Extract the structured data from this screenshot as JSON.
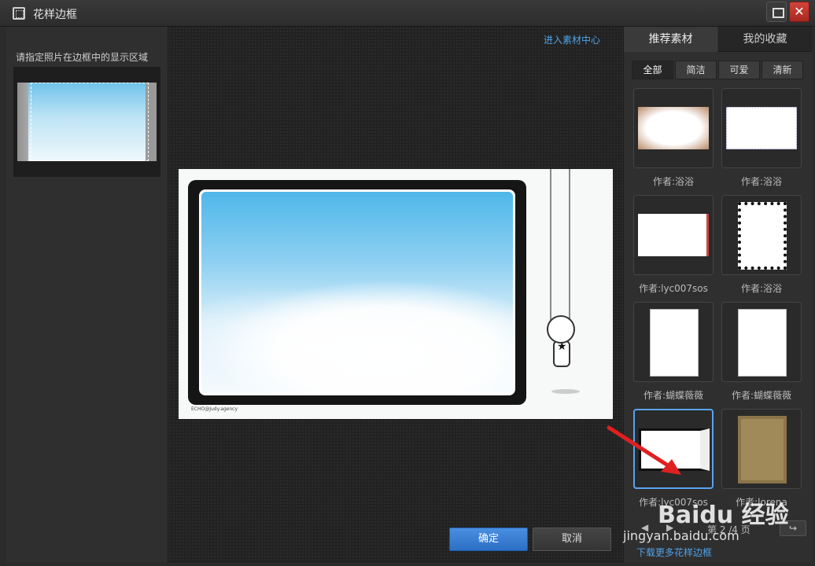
{
  "window": {
    "title": "花样边框",
    "close_glyph": "✕"
  },
  "left_panel": {
    "label": "请指定照片在边框中的显示区域"
  },
  "center": {
    "enter_link": "进入素材中心",
    "preview_credit": "ECHO@Judy.agency",
    "ok_label": "确定",
    "cancel_label": "取消"
  },
  "right_panel": {
    "tabs": [
      {
        "label": "推荐素材"
      },
      {
        "label": "我的收藏"
      }
    ],
    "filters": [
      {
        "label": "全部"
      },
      {
        "label": "简洁"
      },
      {
        "label": "可爱"
      },
      {
        "label": "清新"
      }
    ],
    "items": [
      {
        "caption": "作者:浴浴"
      },
      {
        "caption": "作者:浴浴"
      },
      {
        "caption": "作者:lyc007sos"
      },
      {
        "caption": "作者:浴浴"
      },
      {
        "caption": "作者:蝴蝶薇薇"
      },
      {
        "caption": "作者:蝴蝶薇薇"
      },
      {
        "caption": "作者:lyc007sos"
      },
      {
        "caption": "作者:lorena"
      }
    ],
    "pager": {
      "prev_glyph": "◀",
      "next_glyph": "▶",
      "text": "第 2 /4 页",
      "go_glyph": "↪"
    },
    "download_link": "下载更多花样边框"
  },
  "watermark": {
    "brand": "Baidu 经验",
    "url": "jingyan.baidu.com"
  },
  "colors": {
    "accent": "#4ea3e8",
    "ok_button": "#2b6fc6",
    "close_button": "#c0392b",
    "arrow": "#e02020"
  }
}
